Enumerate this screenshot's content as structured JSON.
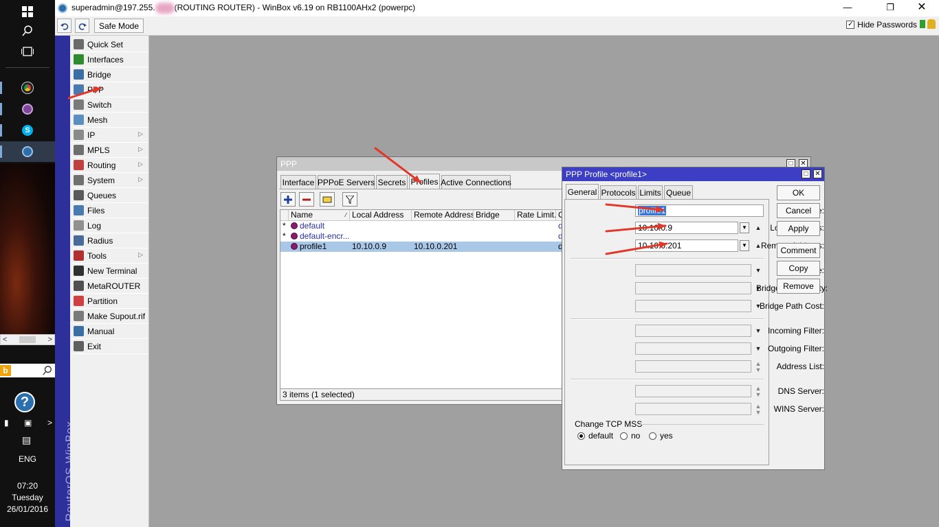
{
  "taskbar": {
    "bing_letter": "b",
    "tray_chevron": ">",
    "language": "ENG",
    "time": "07:20",
    "day": "Tuesday",
    "date": "26/01/2016",
    "apps": [
      {
        "icon": "chrome-icon",
        "color": "#e6a21a"
      },
      {
        "icon": "tor-browser-icon",
        "color": "#7d4698"
      },
      {
        "icon": "skype-icon",
        "color": "#00aff0"
      },
      {
        "icon": "winbox-icon",
        "color": "#2d6da8"
      }
    ]
  },
  "titlebar": {
    "title_prefix": "superadmin@197.255.",
    "title_suffix": "(ROUTING ROUTER) - WinBox v6.19 on RB1100AHx2 (powerpc)"
  },
  "toolbar": {
    "undo_icon": "undo-icon",
    "redo_icon": "redo-icon",
    "safe_mode": "Safe Mode",
    "hide_passwords": "Hide Passwords",
    "hide_passwords_checked": true
  },
  "brand": "RouterOS WinBox",
  "menu": [
    {
      "label": "Quick Set",
      "icon": "quick-set-icon",
      "color": "#6a6a6a",
      "sub": false
    },
    {
      "label": "Interfaces",
      "icon": "interfaces-icon",
      "color": "#2e8b2e",
      "sub": false
    },
    {
      "label": "Bridge",
      "icon": "bridge-icon",
      "color": "#3a6ea5",
      "sub": false
    },
    {
      "label": "PPP",
      "icon": "ppp-icon",
      "color": "#4a7ab0",
      "sub": false
    },
    {
      "label": "Switch",
      "icon": "switch-icon",
      "color": "#7a7a7a",
      "sub": false
    },
    {
      "label": "Mesh",
      "icon": "mesh-icon",
      "color": "#5a8fc0",
      "sub": false
    },
    {
      "label": "IP",
      "icon": "ip-icon",
      "color": "#8a8a8a",
      "sub": true
    },
    {
      "label": "MPLS",
      "icon": "mpls-icon",
      "color": "#6f6f6f",
      "sub": true
    },
    {
      "label": "Routing",
      "icon": "routing-icon",
      "color": "#c04040",
      "sub": true
    },
    {
      "label": "System",
      "icon": "system-icon",
      "color": "#707070",
      "sub": true
    },
    {
      "label": "Queues",
      "icon": "queues-icon",
      "color": "#5a5a5a",
      "sub": false
    },
    {
      "label": "Files",
      "icon": "files-icon",
      "color": "#4a7ab0",
      "sub": false
    },
    {
      "label": "Log",
      "icon": "log-icon",
      "color": "#909090",
      "sub": false
    },
    {
      "label": "Radius",
      "icon": "radius-icon",
      "color": "#4a6a9a",
      "sub": false
    },
    {
      "label": "Tools",
      "icon": "tools-icon",
      "color": "#b03030",
      "sub": true
    },
    {
      "label": "New Terminal",
      "icon": "terminal-icon",
      "color": "#303030",
      "sub": false
    },
    {
      "label": "MetaROUTER",
      "icon": "metarouter-icon",
      "color": "#505050",
      "sub": false
    },
    {
      "label": "Partition",
      "icon": "partition-icon",
      "color": "#d04040",
      "sub": false
    },
    {
      "label": "Make Supout.rif",
      "icon": "supout-icon",
      "color": "#7a7a7a",
      "sub": false
    },
    {
      "label": "Manual",
      "icon": "manual-icon",
      "color": "#3a6ea5",
      "sub": false
    },
    {
      "label": "Exit",
      "icon": "exit-icon",
      "color": "#606060",
      "sub": false
    }
  ],
  "ppp": {
    "title": "PPP",
    "tabs": [
      "Interface",
      "PPPoE Servers",
      "Secrets",
      "Profiles",
      "Active Connections"
    ],
    "active_tab": "Profiles",
    "columns": [
      "Name",
      "Local Address",
      "Remote Address",
      "Bridge",
      "Rate Limit...",
      "O"
    ],
    "rows": [
      {
        "flag": "*",
        "name": "default",
        "local": "",
        "remote": "",
        "bridge": "",
        "rate": "",
        "o": "de",
        "selected": false
      },
      {
        "flag": "*",
        "name": "default-encr...",
        "local": "",
        "remote": "",
        "bridge": "",
        "rate": "",
        "o": "de",
        "selected": false
      },
      {
        "flag": "",
        "name": "profile1",
        "local": "10.10.0.9",
        "remote": "10.10.0.201",
        "bridge": "",
        "rate": "",
        "o": "de",
        "selected": true
      }
    ],
    "status": "3 items (1 selected)"
  },
  "profile": {
    "title": "PPP Profile <profile1>",
    "tabs": [
      "General",
      "Protocols",
      "Limits",
      "Queue"
    ],
    "active_tab": "General",
    "name_label": "Name:",
    "name_value": "profile1",
    "local_label": "Local Address:",
    "local_value": "10.10.0.9",
    "remote_label": "Remote Address:",
    "remote_value": "10.10.0.201",
    "bridge_label": "Bridge:",
    "bpp_label": "Bridge Port Priority:",
    "bpc_label": "Bridge Path Cost:",
    "infilter_label": "Incoming Filter:",
    "outfilter_label": "Outgoing Filter:",
    "addrlist_label": "Address List:",
    "dns_label": "DNS Server:",
    "wins_label": "WINS Server:",
    "mss_label": "Change TCP MSS",
    "mss_options": [
      "default",
      "no",
      "yes"
    ],
    "mss_selected": "default",
    "buttons": [
      "OK",
      "Cancel",
      "Apply",
      "Comment",
      "Copy",
      "Remove"
    ]
  },
  "annotations": {
    "arrow_color": "#e0382a"
  }
}
